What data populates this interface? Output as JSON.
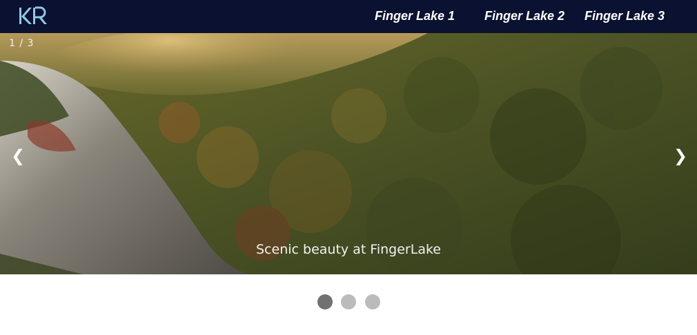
{
  "navbar": {
    "logo_text": "KR",
    "links": [
      {
        "label": "Finger Lake 1"
      },
      {
        "label": "Finger Lake 2"
      },
      {
        "label": "Finger Lake 3"
      }
    ],
    "background": "#0b1130",
    "logo_color": "#8fc9e8"
  },
  "slideshow": {
    "counter": "1 / 3",
    "caption": "Scenic beauty at FingerLake",
    "prev_icon": "❮",
    "next_icon": "❯",
    "image_description_icon": "forest-mountain-photo"
  },
  "dots": {
    "count": 3,
    "active_index": 0,
    "active_color": "#717171",
    "inactive_color": "#bbbbbb"
  }
}
